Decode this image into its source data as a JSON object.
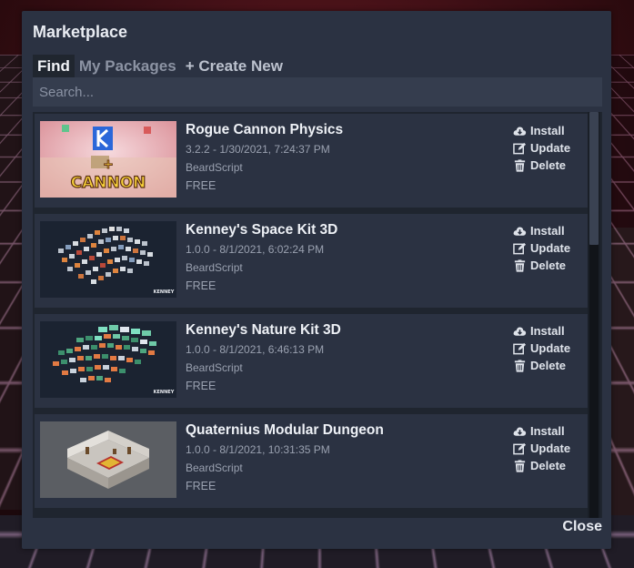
{
  "dialog": {
    "title": "Marketplace",
    "close_label": "Close"
  },
  "tabs": [
    {
      "label": "Find",
      "active": true
    },
    {
      "label": "My Packages",
      "active": false
    },
    {
      "label": "+ Create New",
      "active": false
    }
  ],
  "search": {
    "placeholder": "Search...",
    "value": ""
  },
  "actions": {
    "install": "Install",
    "update": "Update",
    "delete": "Delete"
  },
  "packages": [
    {
      "title": "Rogue Cannon Physics",
      "version_date": "3.2.2 - 1/30/2021, 7:24:37 PM",
      "author": "BeardScript",
      "price": "FREE",
      "thumbnail_text": [
        "+",
        "CANNON"
      ]
    },
    {
      "title": "Kenney's Space Kit 3D",
      "version_date": "1.0.0 - 8/1/2021, 6:02:24 PM",
      "author": "BeardScript",
      "price": "FREE",
      "thumbnail_text": [
        "KENNEY"
      ]
    },
    {
      "title": "Kenney's Nature Kit 3D",
      "version_date": "1.0.0 - 8/1/2021, 6:46:13 PM",
      "author": "BeardScript",
      "price": "FREE",
      "thumbnail_text": [
        "KENNEY"
      ]
    },
    {
      "title": "Quaternius Modular Dungeon",
      "version_date": "1.0.0 - 8/1/2021, 10:31:35 PM",
      "author": "BeardScript",
      "price": "FREE",
      "thumbnail_text": []
    }
  ],
  "icons": {
    "install": "cloud-download-icon",
    "update": "edit-icon",
    "delete": "trash-icon"
  },
  "colors": {
    "dialog_bg": "#2b3242",
    "list_bg": "#1f252f",
    "accent_folder": "#1e6fe0"
  }
}
